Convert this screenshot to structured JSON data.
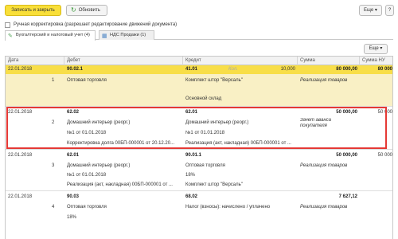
{
  "toolbar": {
    "save_close": "Записать и закрыть",
    "refresh": "Обновить",
    "more": "Еще ▾",
    "help": "?"
  },
  "manual_edit": "Ручная корректировка (разрешает редактирование движений документа)",
  "tabs": [
    {
      "label": "Бухгалтерский и налоговый учет (4)"
    },
    {
      "label": "НДС Продажи (1)"
    }
  ],
  "panel_more": "Еще ▾",
  "columns": {
    "date": "Дата",
    "debit": "Дебет",
    "credit": "Кредит",
    "sum": "Сумма",
    "sum_nu": "Сумма НУ"
  },
  "rows": [
    {
      "date": "22.01.2018",
      "num": "1",
      "debit_acc": "90.02.1",
      "debit_sub1": "Оптовая торговля",
      "credit_acc": "41.01",
      "credit_qty_label": "Кол.",
      "credit_qty": "10,000",
      "credit_sub1": "Комплект штор \"Версаль\"",
      "credit_sub2": "Основной склад",
      "sum": "80 000,00",
      "sum_desc": "Реализация товаров",
      "sum_nu": "80 000"
    },
    {
      "date": "22.01.2018",
      "num": "2",
      "debit_acc": "62.02",
      "debit_sub1": "Домашний интерьер (реорг.)",
      "debit_sub2": "№1 от 01.01.2018",
      "debit_sub3": "Корректировка долга 00БП-000001 от 20.12.20...",
      "credit_acc": "62.01",
      "credit_sub1": "Домашний интерьер (реорг.)",
      "credit_sub2": "№1 от 01.01.2018",
      "credit_sub3": "Реализация (акт, накладная) 00БП-000001 от ...",
      "sum": "50 000,00",
      "sum_desc": "Зачет аванса покупателя",
      "sum_nu": "50 000"
    },
    {
      "date": "22.01.2018",
      "num": "3",
      "debit_acc": "62.01",
      "debit_sub1": "Домашний интерьер (реорг.)",
      "debit_sub2": "№1 от 01.01.2018",
      "debit_sub3": "Реализация (акт, накладная) 00БП-000001 от ...",
      "credit_acc": "90.01.1",
      "credit_sub1": "Оптовая торговля",
      "credit_sub2": "18%",
      "credit_sub3": "Комплект штор \"Версаль\"",
      "sum": "50 000,00",
      "sum_desc": "Реализация товаров",
      "sum_nu": "50 000"
    },
    {
      "date": "22.01.2018",
      "num": "4",
      "debit_acc": "90.03",
      "debit_sub1": "Оптовая торговля",
      "debit_sub2": "18%",
      "credit_acc": "68.02",
      "credit_sub1": "Налог (взносы): начислено / уплачено",
      "sum": "7 627,12",
      "sum_desc": "Реализация товаров"
    }
  ]
}
